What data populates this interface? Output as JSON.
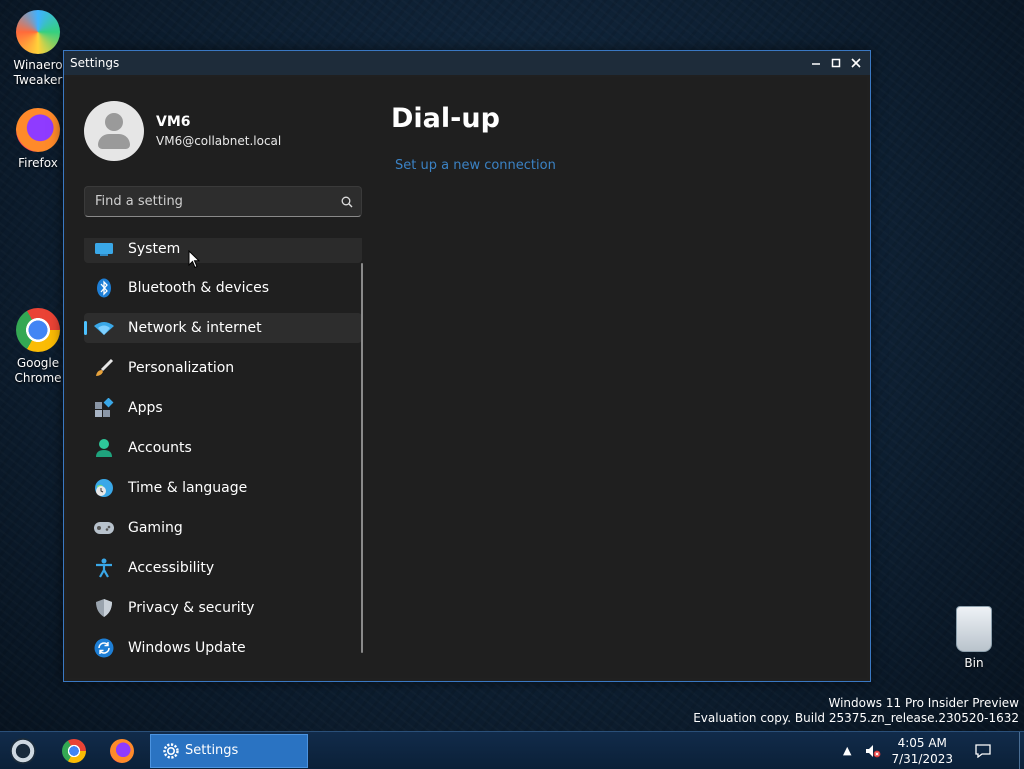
{
  "desktop": {
    "icons": [
      {
        "label": "Winaero\nTweaker",
        "icon": "winaero-tweaker-icon"
      },
      {
        "label": "Firefox",
        "icon": "firefox-icon"
      },
      {
        "label": "Google\nChrome",
        "icon": "chrome-icon"
      },
      {
        "label": "Bin",
        "icon": "recycle-bin-icon"
      }
    ],
    "watermark": {
      "line1": "Windows 11 Pro Insider Preview",
      "line2": "Evaluation copy. Build 25375.zn_release.230520-1632"
    }
  },
  "window": {
    "title": "Settings",
    "controls": {
      "minimize": "–",
      "maximize": "□",
      "close": "✕"
    }
  },
  "profile": {
    "name": "VM6",
    "email": "VM6@collabnet.local"
  },
  "search": {
    "placeholder": "Find a setting",
    "value": ""
  },
  "nav": {
    "items": [
      {
        "label": "System",
        "icon": "system-monitor-icon"
      },
      {
        "label": "Bluetooth & devices",
        "icon": "bluetooth-icon"
      },
      {
        "label": "Network & internet",
        "icon": "wifi-icon",
        "active": true
      },
      {
        "label": "Personalization",
        "icon": "brush-icon"
      },
      {
        "label": "Apps",
        "icon": "apps-icon"
      },
      {
        "label": "Accounts",
        "icon": "person-icon"
      },
      {
        "label": "Time & language",
        "icon": "globe-clock-icon"
      },
      {
        "label": "Gaming",
        "icon": "gamepad-icon"
      },
      {
        "label": "Accessibility",
        "icon": "accessibility-icon"
      },
      {
        "label": "Privacy & security",
        "icon": "shield-icon"
      },
      {
        "label": "Windows Update",
        "icon": "update-icon"
      }
    ]
  },
  "main": {
    "title": "Dial-up",
    "link": "Set up a new connection"
  },
  "taskbar": {
    "settings_label": "Settings",
    "time": "4:05 AM",
    "date": "7/31/2023"
  },
  "colors": {
    "accent": "#4cc2ff",
    "link": "#3b82c4",
    "window_bg": "#1f1f1f",
    "taskbar_active": "#2a73c2"
  }
}
